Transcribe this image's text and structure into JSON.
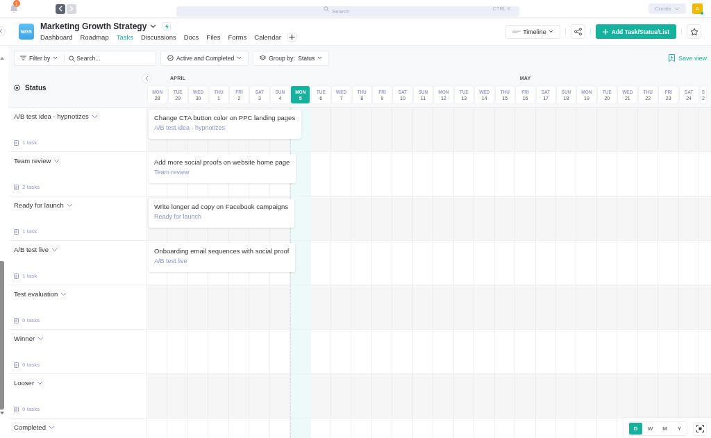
{
  "topbar": {
    "notification_count": "1",
    "search_placeholder": "Search",
    "search_shortcut": "CTRL K",
    "create": "Create",
    "avatar": "A"
  },
  "project": {
    "logo": "MGS",
    "title": "Marketing Growth Strategy",
    "tabs": [
      {
        "label": "Dashboard",
        "selected": false
      },
      {
        "label": "Roadmap",
        "selected": false
      },
      {
        "label": "Tasks",
        "selected": true
      },
      {
        "label": "Discussions",
        "selected": false
      },
      {
        "label": "Docs",
        "selected": false
      },
      {
        "label": "Files",
        "selected": false
      },
      {
        "label": "Forms",
        "selected": false
      },
      {
        "label": "Calendar",
        "selected": false
      }
    ]
  },
  "actions": {
    "view": "Timeline",
    "add": "Add Task/Status/List"
  },
  "toolbar": {
    "filter": "Filter by",
    "search_placeholder": "Search...",
    "status_filter": "Active and Completed",
    "group_by_label": "Group by:",
    "group_by_value": "Status",
    "save_view": "Save view"
  },
  "timeline": {
    "column_header": "Status",
    "days": [
      {
        "dow": "MON",
        "num": "28",
        "today": false
      },
      {
        "dow": "TUE",
        "num": "29",
        "today": false,
        "month": "APRIL"
      },
      {
        "dow": "WED",
        "num": "30",
        "today": false
      },
      {
        "dow": "THU",
        "num": "1",
        "today": false
      },
      {
        "dow": "FRI",
        "num": "2",
        "today": false
      },
      {
        "dow": "SAT",
        "num": "3",
        "today": false
      },
      {
        "dow": "SUN",
        "num": "4",
        "today": false
      },
      {
        "dow": "MON",
        "num": "5",
        "today": true
      },
      {
        "dow": "TUE",
        "num": "6",
        "today": false
      },
      {
        "dow": "WED",
        "num": "7",
        "today": false
      },
      {
        "dow": "THU",
        "num": "8",
        "today": false
      },
      {
        "dow": "FRI",
        "num": "9",
        "today": false
      },
      {
        "dow": "SAT",
        "num": "10",
        "today": false
      },
      {
        "dow": "SUN",
        "num": "11",
        "today": false
      },
      {
        "dow": "MON",
        "num": "12",
        "today": false
      },
      {
        "dow": "TUE",
        "num": "13",
        "today": false
      },
      {
        "dow": "WED",
        "num": "14",
        "today": false
      },
      {
        "dow": "THU",
        "num": "15",
        "today": false
      },
      {
        "dow": "FRI",
        "num": "16",
        "today": false,
        "month": "MAY"
      },
      {
        "dow": "SAT",
        "num": "17",
        "today": false
      },
      {
        "dow": "SUN",
        "num": "18",
        "today": false
      },
      {
        "dow": "MON",
        "num": "19",
        "today": false
      },
      {
        "dow": "TUE",
        "num": "20",
        "today": false
      },
      {
        "dow": "WED",
        "num": "21",
        "today": false
      },
      {
        "dow": "THU",
        "num": "22",
        "today": false
      },
      {
        "dow": "FRI",
        "num": "23",
        "today": false
      },
      {
        "dow": "SAT",
        "num": "24",
        "today": false
      },
      {
        "dow": "S",
        "num": "2",
        "today": false
      }
    ],
    "groups": [
      {
        "name": "A/B test idea - hypnotizes",
        "count": "1 task",
        "tasks": [
          {
            "title": "Change CTA button color on PPC landing pages",
            "status": "A/B test idea - hypnotizes"
          }
        ]
      },
      {
        "name": "Team review",
        "count": "2 tasks",
        "tasks": [
          {
            "title": "Add more social proofs on website home page",
            "status": "Team review"
          }
        ]
      },
      {
        "name": "Ready for launch",
        "count": "1 task",
        "tasks": [
          {
            "title": "Write longer ad copy on Facebook campaigns",
            "status": "Ready for launch"
          }
        ]
      },
      {
        "name": "A/B test live",
        "count": "1 task",
        "tasks": [
          {
            "title": "Onboarding email sequences with social proof",
            "status": "A/B test live"
          }
        ]
      },
      {
        "name": "Test evaluation",
        "count": "0 tasks"
      },
      {
        "name": "Winner",
        "count": "0 tasks"
      },
      {
        "name": "Looser",
        "count": "0 tasks"
      },
      {
        "name": "Completed"
      }
    ]
  },
  "scale": [
    {
      "label": "D",
      "selected": true
    },
    {
      "label": "W",
      "selected": false
    },
    {
      "label": "M",
      "selected": false
    },
    {
      "label": "Y",
      "selected": false
    }
  ]
}
